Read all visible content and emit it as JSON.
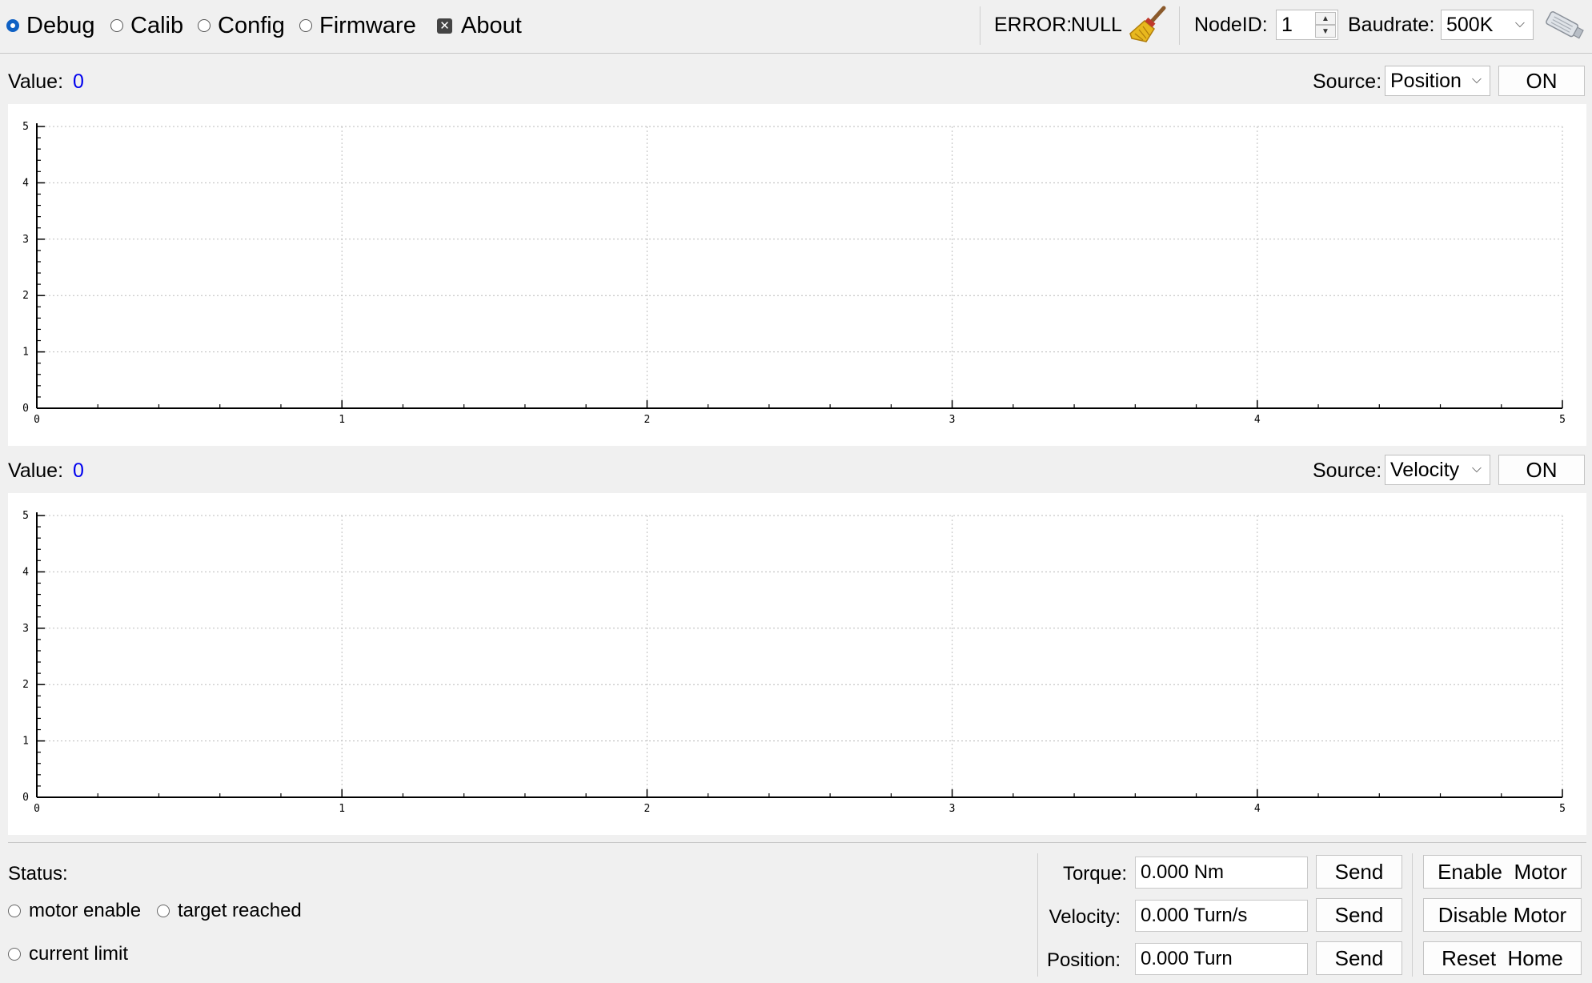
{
  "toolbar": {
    "tabs": [
      {
        "label": "Debug",
        "selected": true
      },
      {
        "label": "Calib",
        "selected": false
      },
      {
        "label": "Config",
        "selected": false
      },
      {
        "label": "Firmware",
        "selected": false
      },
      {
        "label": "About",
        "selected": false
      }
    ],
    "error_label": "ERROR:",
    "error_value": "NULL",
    "clear_icon": "broom-icon",
    "nodeid_label": "NodeID:",
    "nodeid_value": "1",
    "baudrate_label": "Baudrate:",
    "baudrate_value": "500K",
    "connect_icon": "usb-adapter-icon"
  },
  "panels": [
    {
      "value_label": "Value:",
      "value": "0",
      "source_label": "Source:",
      "source_value": "Position",
      "toggle_label": "ON"
    },
    {
      "value_label": "Value:",
      "value": "0",
      "source_label": "Source:",
      "source_value": "Velocity",
      "toggle_label": "ON"
    }
  ],
  "chart_data": [
    {
      "type": "line",
      "x": [],
      "series": [],
      "xlim": [
        0,
        5
      ],
      "ylim": [
        0,
        5
      ],
      "xticks": [
        "0",
        "1",
        "2",
        "3",
        "4",
        "5"
      ],
      "yticks": [
        "0",
        "1",
        "2",
        "3",
        "4",
        "5"
      ],
      "grid": true
    },
    {
      "type": "line",
      "x": [],
      "series": [],
      "xlim": [
        0,
        5
      ],
      "ylim": [
        0,
        5
      ],
      "xticks": [
        "0",
        "1",
        "2",
        "3",
        "4",
        "5"
      ],
      "yticks": [
        "0",
        "1",
        "2",
        "3",
        "4",
        "5"
      ],
      "grid": true
    }
  ],
  "status": {
    "label": "Status:",
    "items": [
      {
        "label": "motor enable",
        "checked": false
      },
      {
        "label": "target reached",
        "checked": false
      },
      {
        "label": "current limit",
        "checked": false
      }
    ]
  },
  "commands": [
    {
      "label": "Torque:",
      "value": "0.000 Nm",
      "button": "Send"
    },
    {
      "label": "Velocity:",
      "value": "0.000 Turn/s",
      "button": "Send"
    },
    {
      "label": "Position:",
      "value": "0.000 Turn",
      "button": "Send"
    }
  ],
  "motor_buttons": {
    "enable": "Enable  Motor",
    "disable": "Disable Motor",
    "reset": "Reset  Home"
  },
  "colors": {
    "accent": "#0f61c4",
    "value_text": "#0000ee",
    "plot_bg": "#ffffff",
    "window_bg": "#f0f0f0",
    "grid": "#bbbbbb"
  }
}
